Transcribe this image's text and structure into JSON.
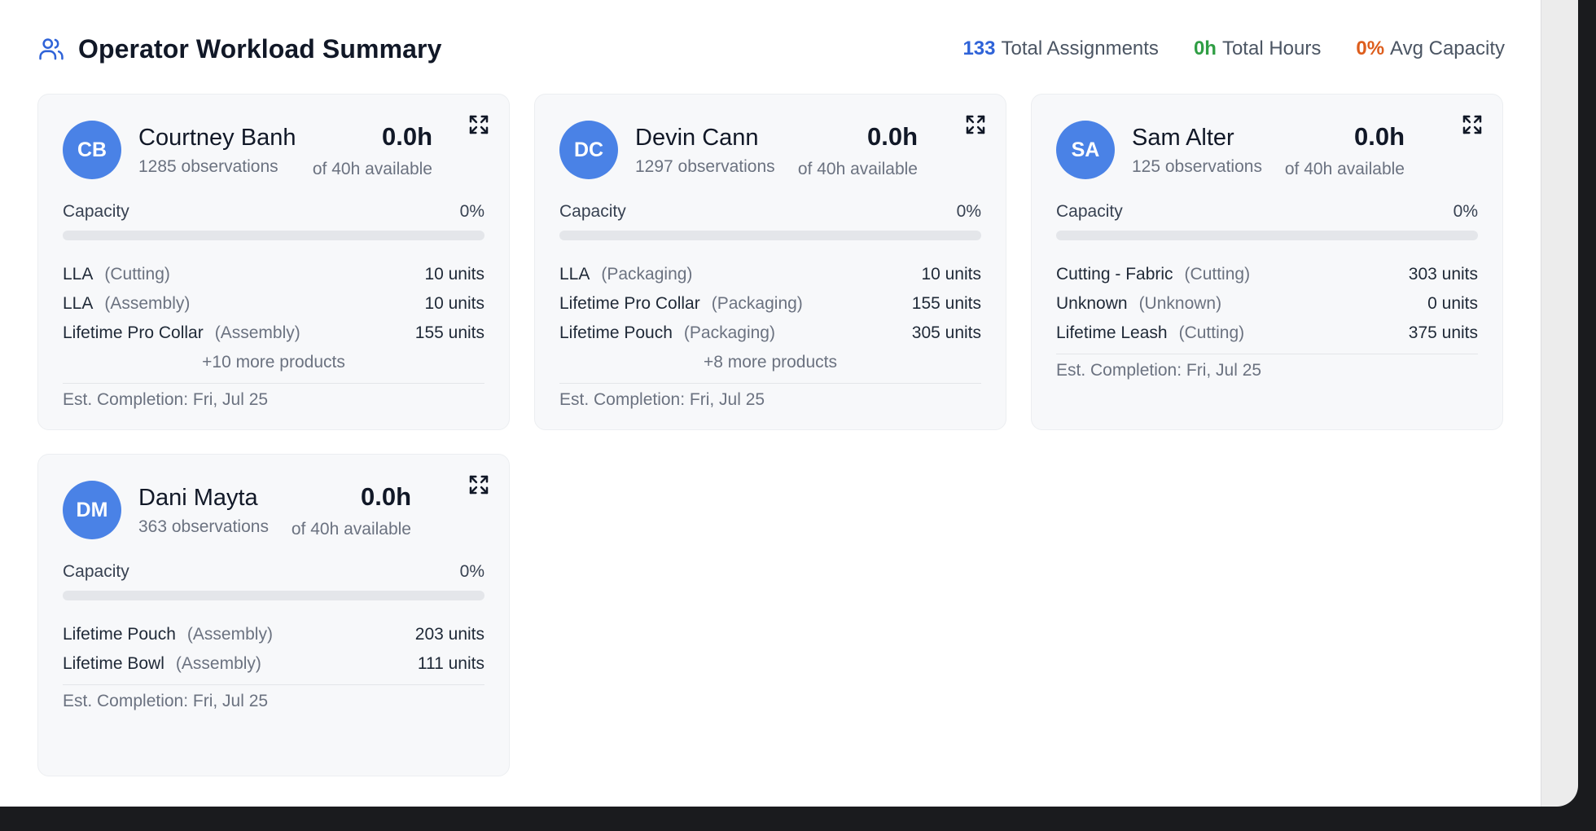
{
  "header": {
    "title": "Operator Workload Summary",
    "icon": "users-icon",
    "stats": {
      "assignments_value": "133",
      "assignments_label": "Total Assignments",
      "hours_value": "0h",
      "hours_label": "Total Hours",
      "capacity_value": "0%",
      "capacity_label": "Avg Capacity"
    }
  },
  "colors": {
    "accent_blue": "#2f63d8",
    "hours_green": "#2f9e44",
    "capacity_orange": "#dd5d1c",
    "avatar_blue": "#4a82e6"
  },
  "operators": [
    {
      "initials": "CB",
      "name": "Courtney Banh",
      "observations": "1285 observations",
      "hours": "0.0h",
      "available": "of 40h available",
      "capacity_label": "Capacity",
      "capacity_value": "0%",
      "capacity_fraction": 0,
      "products": [
        {
          "name": "LLA",
          "stage": "(Cutting)",
          "units": "10 units"
        },
        {
          "name": "LLA",
          "stage": "(Assembly)",
          "units": "10 units"
        },
        {
          "name": "Lifetime Pro Collar",
          "stage": "(Assembly)",
          "units": "155 units"
        }
      ],
      "more": "+10 more products",
      "completion": "Est. Completion: Fri, Jul 25"
    },
    {
      "initials": "DC",
      "name": "Devin Cann",
      "observations": "1297 observations",
      "hours": "0.0h",
      "available": "of 40h available",
      "capacity_label": "Capacity",
      "capacity_value": "0%",
      "capacity_fraction": 0,
      "products": [
        {
          "name": "LLA",
          "stage": "(Packaging)",
          "units": "10 units"
        },
        {
          "name": "Lifetime Pro Collar",
          "stage": "(Packaging)",
          "units": "155 units"
        },
        {
          "name": "Lifetime Pouch",
          "stage": "(Packaging)",
          "units": "305 units"
        }
      ],
      "more": "+8 more products",
      "completion": "Est. Completion: Fri, Jul 25"
    },
    {
      "initials": "SA",
      "name": "Sam Alter",
      "observations": "125 observations",
      "hours": "0.0h",
      "available": "of 40h available",
      "capacity_label": "Capacity",
      "capacity_value": "0%",
      "capacity_fraction": 0,
      "products": [
        {
          "name": "Cutting - Fabric",
          "stage": "(Cutting)",
          "units": "303 units"
        },
        {
          "name": "Unknown",
          "stage": "(Unknown)",
          "units": "0 units"
        },
        {
          "name": "Lifetime Leash",
          "stage": "(Cutting)",
          "units": "375 units"
        }
      ],
      "more": "",
      "completion": "Est. Completion: Fri, Jul 25"
    },
    {
      "initials": "DM",
      "name": "Dani Mayta",
      "observations": "363 observations",
      "hours": "0.0h",
      "available": "of 40h available",
      "capacity_label": "Capacity",
      "capacity_value": "0%",
      "capacity_fraction": 0,
      "products": [
        {
          "name": "Lifetime Pouch",
          "stage": "(Assembly)",
          "units": "203 units"
        },
        {
          "name": "Lifetime Bowl",
          "stage": "(Assembly)",
          "units": "111 units"
        }
      ],
      "more": "",
      "completion": "Est. Completion: Fri, Jul 25"
    }
  ]
}
